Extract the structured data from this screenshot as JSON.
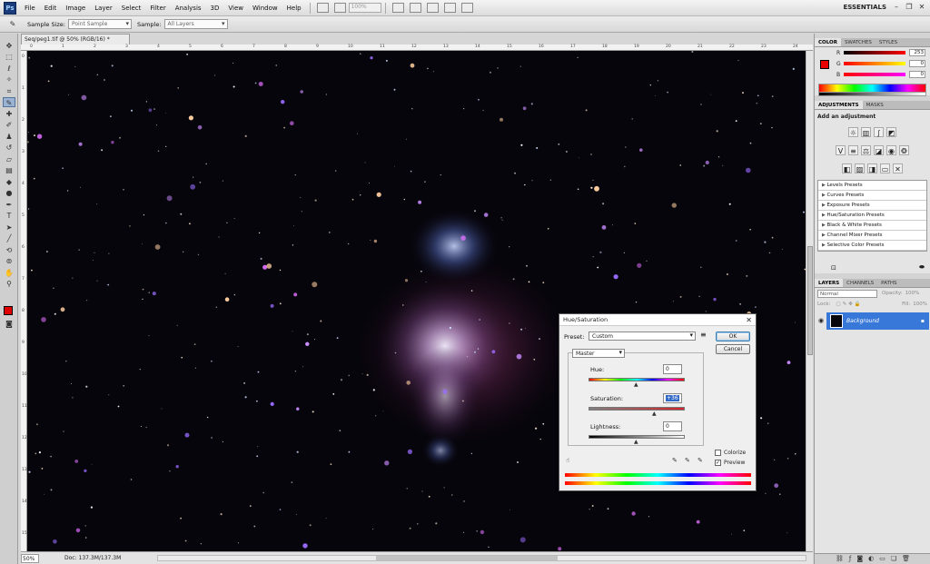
{
  "app": {
    "logo": "Ps"
  },
  "menu": [
    "File",
    "Edit",
    "Image",
    "Layer",
    "Select",
    "Filter",
    "Analysis",
    "3D",
    "View",
    "Window",
    "Help"
  ],
  "menubar": {
    "zoom": "100%",
    "workspace": "ESSENTIALS"
  },
  "options_bar": {
    "sample_size_label": "Sample Size:",
    "sample_size_value": "Point Sample",
    "sample_label": "Sample:",
    "sample_value": "All Layers"
  },
  "document": {
    "tab_title": "Seq/peg1.tif @ 50% (RGB/16) *",
    "ruler_numbers": [
      "0",
      "1",
      "2",
      "3",
      "4",
      "5",
      "6",
      "7",
      "8",
      "9",
      "10",
      "11",
      "12",
      "13",
      "14",
      "15",
      "16",
      "17",
      "18",
      "19",
      "20",
      "21",
      "22",
      "23",
      "24"
    ],
    "zoom": "50%",
    "doc_info": "Doc: 137.3M/137.3M"
  },
  "color_panel": {
    "tabs": [
      "COLOR",
      "SWATCHES",
      "STYLES"
    ],
    "channels": [
      {
        "name": "R",
        "value": "253"
      },
      {
        "name": "G",
        "value": "0"
      },
      {
        "name": "B",
        "value": "0"
      }
    ],
    "foreground_color": "#e90000"
  },
  "adjustments_panel": {
    "tabs": [
      "ADJUSTMENTS",
      "MASKS"
    ],
    "heading": "Add an adjustment",
    "presets": [
      "Levels Presets",
      "Curves Presets",
      "Exposure Presets",
      "Hue/Saturation Presets",
      "Black & White Presets",
      "Channel Mixer Presets",
      "Selective Color Presets"
    ]
  },
  "layers_panel": {
    "tabs": [
      "LAYERS",
      "CHANNELS",
      "PATHS"
    ],
    "blend_mode": "Normal",
    "opacity_label": "Opacity:",
    "opacity_value": "100%",
    "lock_label": "Lock:",
    "fill_label": "Fill:",
    "fill_value": "100%",
    "layer_name": "Background"
  },
  "dialog": {
    "title": "Hue/Saturation",
    "preset_label": "Preset:",
    "preset_value": "Custom",
    "ok": "OK",
    "cancel": "Cancel",
    "channel": "Master",
    "hue_label": "Hue:",
    "hue_value": "0",
    "saturation_label": "Saturation:",
    "saturation_value": "+36",
    "lightness_label": "Lightness:",
    "lightness_value": "0",
    "colorize_label": "Colorize",
    "colorize_checked": false,
    "preview_label": "Preview",
    "preview_checked": true
  }
}
